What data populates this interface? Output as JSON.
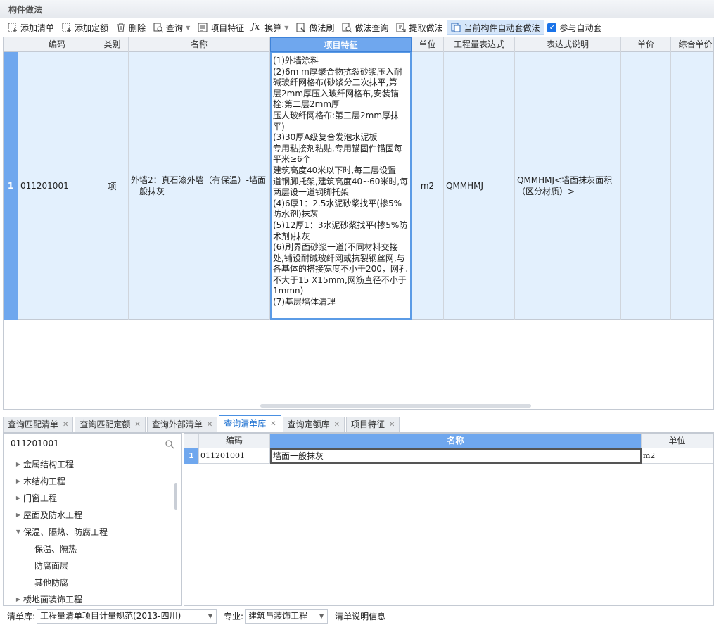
{
  "panel": {
    "title": "构件做法"
  },
  "toolbar": {
    "add_list": "添加清单",
    "add_quota": "添加定额",
    "delete": "删除",
    "query": "查询",
    "item_feature": "项目特征",
    "convert": "换算",
    "method_brush": "做法刷",
    "method_query": "做法查询",
    "extract_method": "提取做法",
    "auto_apply_current": "当前构件自动套做法",
    "join_auto_apply": "参与自动套"
  },
  "grid1": {
    "headers": [
      "编码",
      "类别",
      "名称",
      "项目特征",
      "单位",
      "工程量表达式",
      "表达式说明",
      "单价",
      "综合单价"
    ],
    "row": {
      "index": "1",
      "code": "011201001",
      "category": "项",
      "name": "外墙2：真石漆外墙（有保温）-墙面一般抹灰",
      "features": "(1)外墙涂料\n(2)6m m厚聚合物抗裂砂浆压入耐碱玻纤网格布(砂浆分三次抹平,第一层2mm厚压入玻纤网格布,安装锚栓:第二层2mm厚\n压人玻纤网格布:第三层2mm厚抹平)\n(3)30厚A级复合发泡水泥板\n专用粘接剂粘贴,专用锚固件锚固每平米≥6个\n建筑高度40米以下时,每三层设置一道钢脚托架,建筑高度40~60米时,每两层设一道钢脚托架\n(4)6厚1：2.5水泥砂浆找平(掺5%防水剂)抹灰\n(5)12厚1：3水泥砂浆找平(掺5%防术剂)抹灰\n(6)刷界面砂浆一道(不同材料交接处,铺设耐碱玻纤网或抗裂钢丝网,与各基体的搭接宽度不小于200，网孔不大于15 X15mm,网筋直径不小于1mmn)\n(7)基层墙体清理",
      "unit": "m2",
      "expression": "QMMHMJ",
      "expression_desc": "QMMHMJ<墙面抹灰面积（区分材质）>",
      "price": "",
      "composite_price": ""
    }
  },
  "tabs": [
    "查询匹配清单",
    "查询匹配定额",
    "查询外部清单",
    "查询清单库",
    "查询定额库",
    "项目特征"
  ],
  "search": {
    "value": "011201001"
  },
  "tree": [
    {
      "label": "金属结构工程",
      "expanded": false,
      "level": 0
    },
    {
      "label": "木结构工程",
      "expanded": false,
      "level": 0
    },
    {
      "label": "门窗工程",
      "expanded": false,
      "level": 0
    },
    {
      "label": "屋面及防水工程",
      "expanded": false,
      "level": 0
    },
    {
      "label": "保温、隔热、防腐工程",
      "expanded": true,
      "level": 0
    },
    {
      "label": "保温、隔热",
      "level": 1
    },
    {
      "label": "防腐面层",
      "level": 1
    },
    {
      "label": "其他防腐",
      "level": 1
    },
    {
      "label": "楼地面装饰工程",
      "expanded": false,
      "level": 0
    }
  ],
  "grid2": {
    "headers": [
      "编码",
      "名称",
      "单位"
    ],
    "row": {
      "index": "1",
      "code": "011201001",
      "name": "墙面一般抹灰",
      "unit": "m2"
    }
  },
  "status": {
    "library_label": "清单库:",
    "library_value": "工程量清单项目计量规范(2013-四川)",
    "specialty_label": "专业:",
    "specialty_value": "建筑与装饰工程",
    "info": "清单说明信息"
  }
}
